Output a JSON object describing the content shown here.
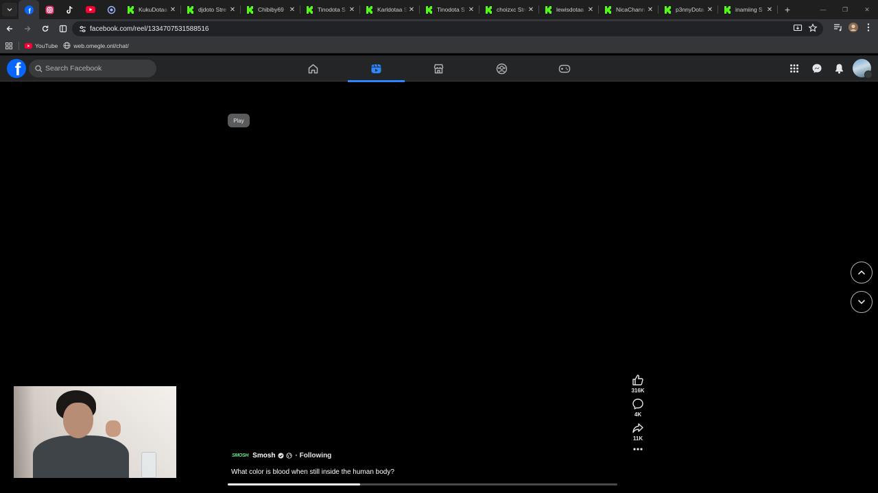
{
  "browser": {
    "tabs_pinned": [
      {
        "icon": "facebook-icon",
        "active": true
      },
      {
        "icon": "instagram-icon"
      },
      {
        "icon": "tiktok-icon"
      },
      {
        "icon": "youtube-icon"
      },
      {
        "icon": "chatgpt-icon"
      }
    ],
    "tabs": [
      {
        "title": "KukuDotaa",
        "icon": "kick-icon"
      },
      {
        "title": "djdoto Stre",
        "icon": "kick-icon"
      },
      {
        "title": "Chibiby69",
        "icon": "kick-icon"
      },
      {
        "title": "Tinodota S",
        "icon": "kick-icon"
      },
      {
        "title": "Karldotaa S",
        "icon": "kick-icon"
      },
      {
        "title": "Tinodota S",
        "icon": "kick-icon"
      },
      {
        "title": "choizxc Stre",
        "icon": "kick-icon"
      },
      {
        "title": "lewisdotaa",
        "icon": "kick-icon"
      },
      {
        "title": "NicaChann",
        "icon": "kick-icon"
      },
      {
        "title": "p3nnyDota",
        "icon": "kick-icon"
      },
      {
        "title": "inamiing S",
        "icon": "kick-icon"
      }
    ],
    "url": "facebook.com/reel/1334707531588516",
    "bookmarks": [
      {
        "label": "YouTube",
        "icon": "youtube-icon"
      },
      {
        "label": "web.omegle.onl/chat/",
        "icon": "globe-icon"
      }
    ]
  },
  "facebook": {
    "search_placeholder": "Search Facebook",
    "nav_tabs": [
      {
        "name": "home",
        "icon": "home-icon"
      },
      {
        "name": "reels",
        "icon": "reels-icon",
        "active": true
      },
      {
        "name": "marketplace",
        "icon": "marketplace-icon"
      },
      {
        "name": "groups",
        "icon": "groups-icon"
      },
      {
        "name": "gaming",
        "icon": "gaming-icon"
      }
    ]
  },
  "reel": {
    "play_tooltip": "Play",
    "likes": "316K",
    "comments": "4K",
    "shares": "11K",
    "author_logo": "SMOSH",
    "author_name": "Smosh",
    "follow_status": "· Following",
    "caption": "What color is blood when still inside the human body?",
    "progress": 0.34
  },
  "colors": {
    "accent": "#2d88ff",
    "facebook_blue": "#0866ff",
    "kick_green": "#53fc18",
    "header_bg": "#242526"
  }
}
